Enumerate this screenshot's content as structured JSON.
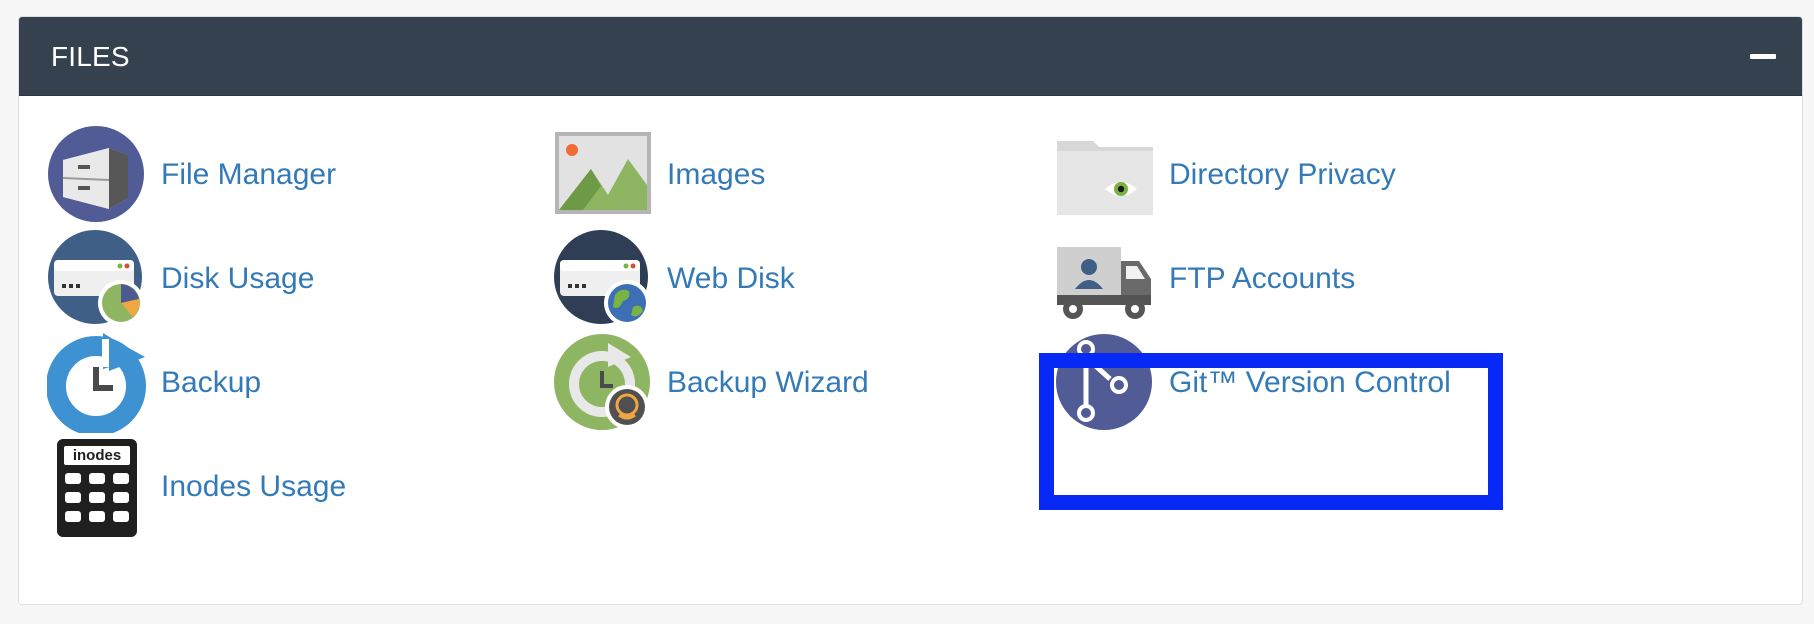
{
  "panel": {
    "title": "FILES",
    "collapse_icon": "minus-icon"
  },
  "tools": [
    {
      "id": "file-manager",
      "label": "File Manager",
      "icon": "file-manager-icon"
    },
    {
      "id": "images",
      "label": "Images",
      "icon": "images-icon"
    },
    {
      "id": "directory-privacy",
      "label": "Directory Privacy",
      "icon": "directory-privacy-icon"
    },
    {
      "id": "disk-usage",
      "label": "Disk Usage",
      "icon": "disk-usage-icon"
    },
    {
      "id": "web-disk",
      "label": "Web Disk",
      "icon": "web-disk-icon"
    },
    {
      "id": "ftp-accounts",
      "label": "FTP Accounts",
      "icon": "ftp-accounts-icon"
    },
    {
      "id": "backup",
      "label": "Backup",
      "icon": "backup-icon"
    },
    {
      "id": "backup-wizard",
      "label": "Backup Wizard",
      "icon": "backup-wizard-icon"
    },
    {
      "id": "git-version-control",
      "label": "Git™ Version Control",
      "icon": "git-branch-icon",
      "highlighted": true
    },
    {
      "id": "inodes-usage",
      "label": "Inodes Usage",
      "icon": "inodes-usage-icon",
      "icon_text": "inodes"
    }
  ],
  "colors": {
    "header_bg": "#36414f",
    "link": "#337ab7",
    "highlight_border": "#0729f5",
    "icon_purple": "#515c96",
    "backup_blue": "#3f92d2",
    "wizard_green": "#8db562"
  }
}
